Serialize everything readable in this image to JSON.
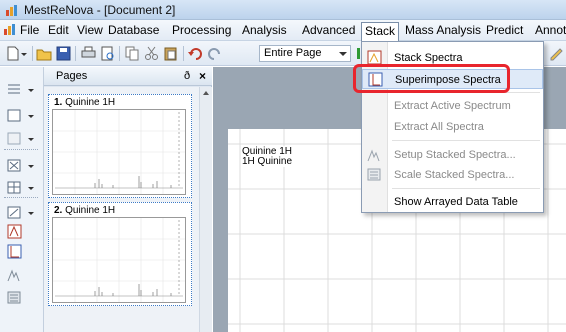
{
  "window": {
    "title": "MestReNova - [Document 2]"
  },
  "menubar": {
    "items": [
      {
        "label": "File"
      },
      {
        "label": "Edit"
      },
      {
        "label": "View"
      },
      {
        "label": "Database"
      },
      {
        "label": "Processing"
      },
      {
        "label": "Analysis"
      },
      {
        "label": "Advanced"
      },
      {
        "label": "Stack"
      },
      {
        "label": "Mass Analysis"
      },
      {
        "label": "Predict"
      },
      {
        "label": "Annot"
      }
    ],
    "active": "Stack"
  },
  "toolbar": {
    "page_select": "Entire Page"
  },
  "pages_panel": {
    "title": "Pages",
    "pin": "ð",
    "close": "×",
    "pages": [
      {
        "number": "1.",
        "label": "Quinine 1H"
      },
      {
        "number": "2.",
        "label": "Quinine 1H"
      }
    ]
  },
  "document": {
    "title_line1": "Quinine 1H",
    "title_line2": "1H Quinine"
  },
  "stack_menu": {
    "items": [
      {
        "label": "Stack Spectra",
        "icon": "stack-spectra-icon",
        "enabled": true
      },
      {
        "label": "Superimpose Spectra",
        "icon": "superimpose-icon",
        "enabled": true
      },
      {
        "label": "Extract Active Spectrum",
        "icon": "",
        "enabled": false
      },
      {
        "label": "Extract All Spectra",
        "icon": "",
        "enabled": false
      },
      {
        "label": "Setup Stacked Spectra...",
        "icon": "setup-stacked-icon",
        "enabled": false
      },
      {
        "label": "Scale Stacked Spectra...",
        "icon": "scale-stacked-icon",
        "enabled": false
      },
      {
        "label": "Show Arrayed Data Table",
        "icon": "",
        "enabled": true
      }
    ],
    "highlighted": "Superimpose Spectra"
  },
  "colors": {
    "highlight": "#e8252d",
    "selection": "#3d7bc6",
    "canvas": "#9aa6b3"
  }
}
